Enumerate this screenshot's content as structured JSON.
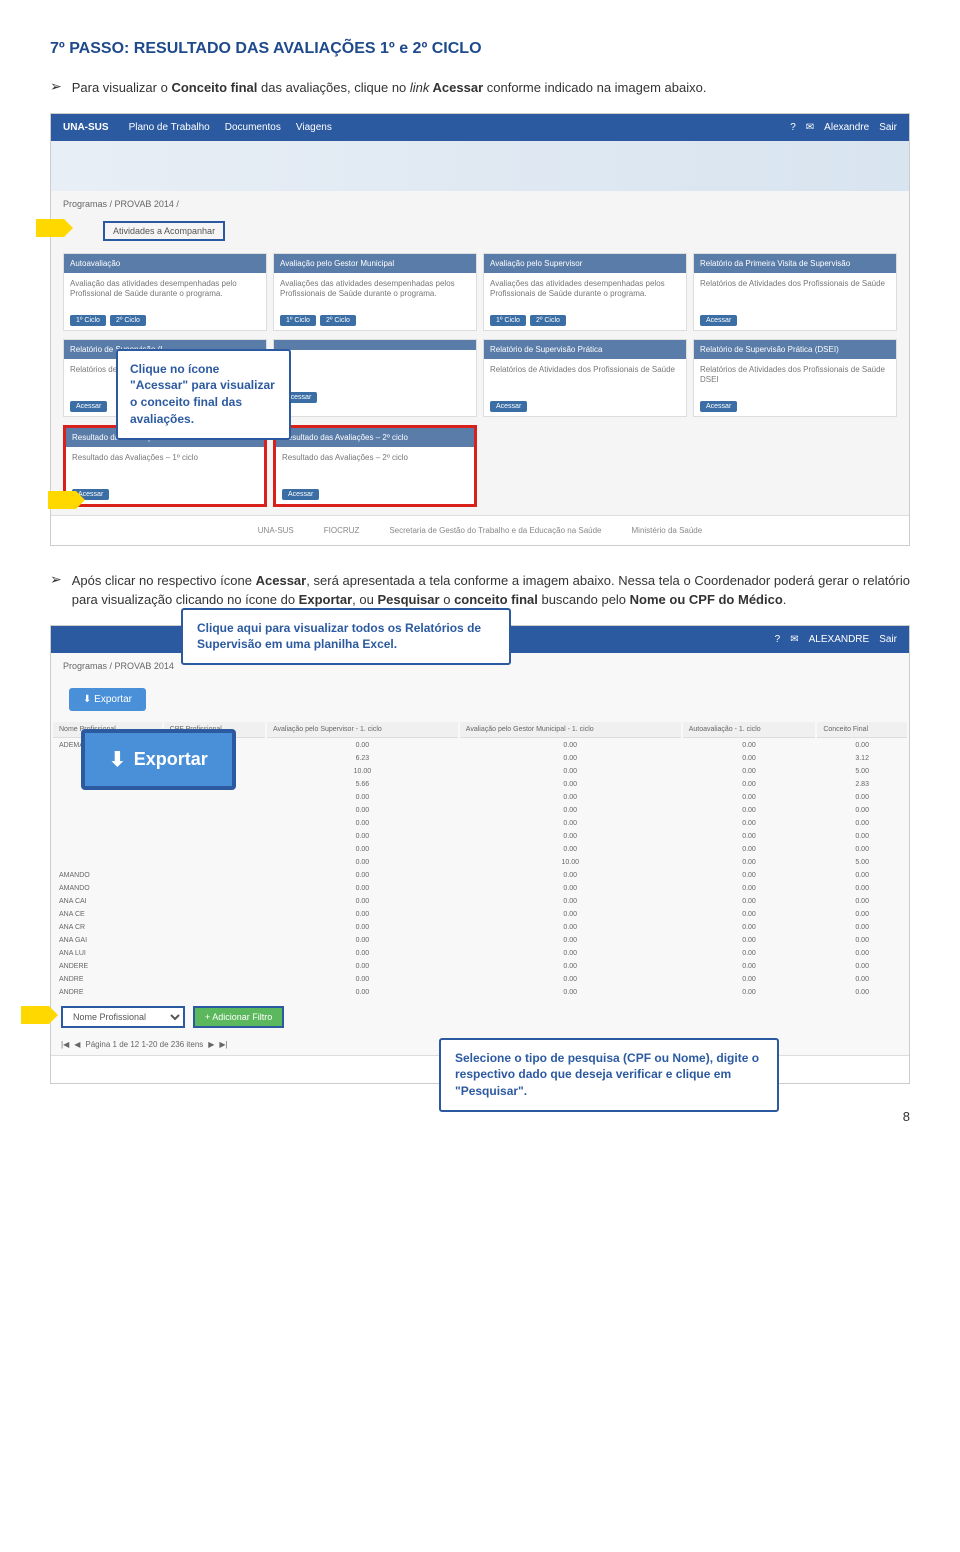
{
  "heading": "7º PASSO: RESULTADO DAS AVALIAÇÕES 1º e 2º CICLO",
  "bullets": {
    "b1_prefix": "Para visualizar o ",
    "b1_bold1": "Conceito final",
    "b1_mid": " das avaliações, clique no ",
    "b1_italic": "link",
    "b1_bold2": " Acessar",
    "b1_suffix": " conforme indicado na imagem abaixo.",
    "b2_prefix": "Após clicar no respectivo ícone ",
    "b2_bold1": "Acessar",
    "b2_mid1": ", será apresentada a tela conforme a imagem abaixo. Nessa tela o Coordenador poderá gerar o relatório para visualização clicando no ícone do ",
    "b2_bold2": "Exportar",
    "b2_mid2": ", ou ",
    "b2_bold3": "Pesquisar",
    "b2_mid3": " o ",
    "b2_bold4": "conceito final",
    "b2_mid4": " buscando pelo ",
    "b2_bold5": "Nome ou CPF do Médico",
    "b2_suffix": "."
  },
  "callout1": "Clique no ícone \"Acessar\" para visualizar o conceito final das avaliações.",
  "callout2": "Clique aqui para visualizar todos os Relatórios de Supervisão em uma planilha Excel.",
  "callout3": "Selecione o tipo de pesquisa (CPF ou Nome), digite o respectivo dado que deseja verificar e clique em \"Pesquisar\".",
  "ss1": {
    "logo": "UNA-SUS",
    "nav": [
      "Plano de Trabalho",
      "Documentos",
      "Viagens"
    ],
    "user": "Alexandre",
    "sair": "Sair",
    "breadcrumb": "Programas / PROVAB 2014 /",
    "tab": "Atividades a Acompanhar",
    "cards_row1": [
      {
        "title": "Autoavaliação",
        "body": "Avaliação das atividades desempenhadas pelo Profissional de Saúde durante o programa.",
        "btns": [
          "1º Ciclo",
          "2º Ciclo"
        ]
      },
      {
        "title": "Avaliação pelo Gestor Municipal",
        "body": "Avaliações das atividades desempenhadas pelos Profissionais de Saúde durante o programa.",
        "btns": [
          "1º Ciclo",
          "2º Ciclo"
        ]
      },
      {
        "title": "Avaliação pelo Supervisor",
        "body": "Avaliações das atividades desempenhadas pelos Profissionais de Saúde durante o programa.",
        "btns": [
          "1º Ciclo",
          "2º Ciclo"
        ]
      },
      {
        "title": "Relatório da Primeira Visita de Supervisão",
        "body": "Relatórios de Atividades dos Profissionais de Saúde",
        "btns": [
          "Acessar"
        ]
      }
    ],
    "cards_row2": [
      {
        "title": "Relatório de Supervisão (L",
        "body": "Relatórios de",
        "btns": [
          "Acessar"
        ]
      },
      {
        "title": "",
        "body": "",
        "btns": [
          "Acessar"
        ]
      },
      {
        "title": "Relatório de Supervisão Prática",
        "body": "Relatórios de Atividades dos Profissionais de Saúde",
        "btns": [
          "Acessar"
        ]
      },
      {
        "title": "Relatório de Supervisão Prática (DSEI)",
        "body": "Relatórios de Atividades dos Profissionais de Saúde DSEI",
        "btns": [
          "Acessar"
        ]
      }
    ],
    "cards_row3": [
      {
        "title": "Resultado das Avaliações – 1º ciclo",
        "body": "Resultado das Avaliações – 1º ciclo",
        "btns": [
          "Acessar"
        ]
      },
      {
        "title": "Resultado das Avaliações – 2º ciclo",
        "body": "Resultado das Avaliações – 2º ciclo",
        "btns": [
          "Acessar"
        ]
      }
    ],
    "footer": [
      "UNA-SUS",
      "FIOCRUZ",
      "Secretaria de Gestão do Trabalho e da Educação na Saúde",
      "Ministério da Saúde"
    ]
  },
  "ss2": {
    "user": "ALEXANDRE",
    "sair": "Sair",
    "breadcrumb": "Programas / PROVAB 2014",
    "exportar_small": "Exportar",
    "exportar_big": "Exportar",
    "table_headers": [
      "Nome Profissional",
      "CPF Profissional",
      "Avaliação pelo Supervisor - 1. ciclo",
      "Avaliação pelo Gestor Municipal - 1. ciclo",
      "Autoavaliação - 1. ciclo",
      "Conceito Final"
    ],
    "names": [
      "ADEMAR",
      "",
      "",
      "",
      "",
      "",
      "",
      "",
      "",
      "",
      "AMANDO",
      "AMANDO",
      "ANA CAI",
      "ANA CE",
      "ANA CR",
      "ANA GAI",
      "ANA LUI",
      "ANDERE",
      "ANDRE",
      "ANDRE"
    ],
    "table_rows": [
      [
        "0.00",
        "0.00",
        "0.00",
        "0.00"
      ],
      [
        "6.23",
        "0.00",
        "0.00",
        "3.12"
      ],
      [
        "10.00",
        "0.00",
        "0.00",
        "5.00"
      ],
      [
        "5.66",
        "0.00",
        "0.00",
        "2.83"
      ],
      [
        "0.00",
        "0.00",
        "0.00",
        "0.00"
      ],
      [
        "0.00",
        "0.00",
        "0.00",
        "0.00"
      ],
      [
        "0.00",
        "0.00",
        "0.00",
        "0.00"
      ],
      [
        "0.00",
        "0.00",
        "0.00",
        "0.00"
      ],
      [
        "0.00",
        "0.00",
        "0.00",
        "0.00"
      ],
      [
        "0.00",
        "10.00",
        "0.00",
        "5.00"
      ],
      [
        "0.00",
        "0.00",
        "0.00",
        "0.00"
      ],
      [
        "0.00",
        "0.00",
        "0.00",
        "0.00"
      ],
      [
        "0.00",
        "0.00",
        "0.00",
        "0.00"
      ],
      [
        "0.00",
        "0.00",
        "0.00",
        "0.00"
      ],
      [
        "0.00",
        "0.00",
        "0.00",
        "0.00"
      ],
      [
        "0.00",
        "0.00",
        "0.00",
        "0.00"
      ],
      [
        "0.00",
        "0.00",
        "0.00",
        "0.00"
      ],
      [
        "0.00",
        "0.00",
        "0.00",
        "0.00"
      ],
      [
        "0.00",
        "0.00",
        "0.00",
        "0.00"
      ],
      [
        "0.00",
        "0.00",
        "0.00",
        "0.00"
      ]
    ],
    "filter_select": "Nome Profissional",
    "filter_options": [
      "Nome Profissional",
      "CPF Profissional"
    ],
    "add_filter": "+ Adicionar Filtro",
    "pagination": "Página 1   de 12    1-20 de 236 itens"
  },
  "page_number": "8"
}
